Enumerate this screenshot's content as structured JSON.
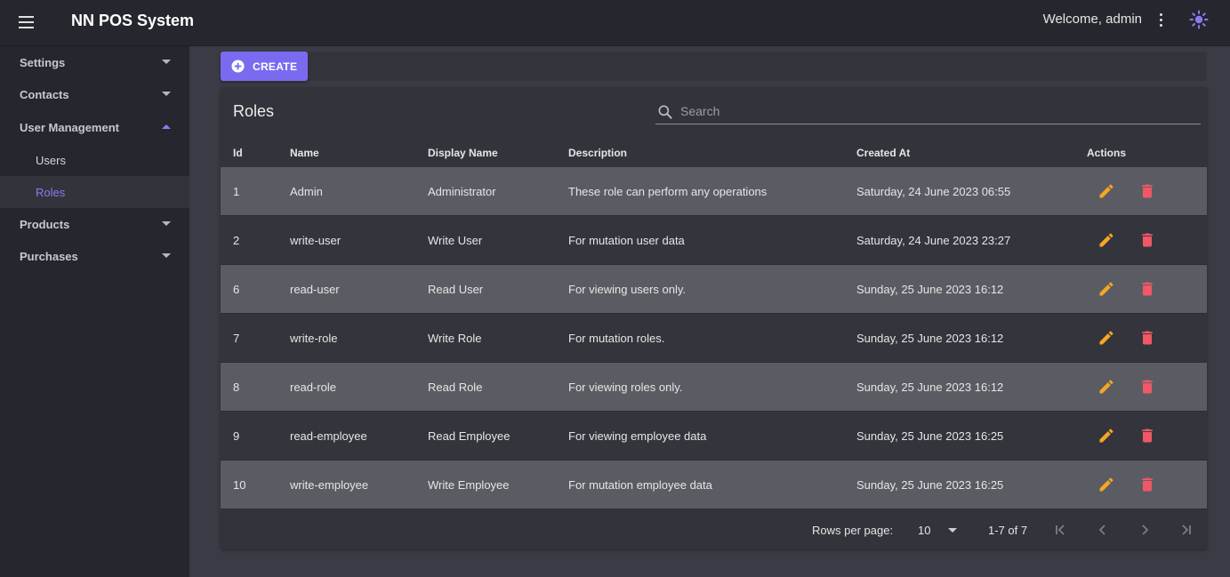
{
  "app": {
    "title": "NN POS System",
    "welcome": "Welcome, admin"
  },
  "colors": {
    "accent": "#7a6af0",
    "edit": "#f5a623",
    "delete": "#ef5867",
    "active_nav": "#8a7bf0"
  },
  "icons": {
    "menu": "menu-icon",
    "more": "more-vert-icon",
    "theme": "brightness-icon",
    "search": "search-icon",
    "add": "add-circle-icon",
    "edit": "pencil-icon",
    "delete": "trash-icon"
  },
  "sidebar": {
    "items": [
      {
        "label": "Settings"
      },
      {
        "label": "Contacts"
      },
      {
        "label": "User Management"
      },
      {
        "label": "Users"
      },
      {
        "label": "Roles"
      },
      {
        "label": "Products"
      },
      {
        "label": "Purchases"
      }
    ]
  },
  "toolbar": {
    "create_label": "CREATE"
  },
  "card": {
    "title": "Roles",
    "search_placeholder": "Search"
  },
  "table": {
    "columns": [
      "Id",
      "Name",
      "Display Name",
      "Description",
      "Created At",
      "Actions"
    ],
    "rows": [
      {
        "id": "1",
        "name": "Admin",
        "display": "Administrator",
        "desc": "These role can perform any operations",
        "created": "Saturday, 24 June 2023 06:55"
      },
      {
        "id": "2",
        "name": "write-user",
        "display": "Write User",
        "desc": "For mutation user data",
        "created": "Saturday, 24 June 2023 23:27"
      },
      {
        "id": "6",
        "name": "read-user",
        "display": "Read User",
        "desc": "For viewing users only.",
        "created": "Sunday, 25 June 2023 16:12"
      },
      {
        "id": "7",
        "name": "write-role",
        "display": "Write Role",
        "desc": "For mutation roles.",
        "created": "Sunday, 25 June 2023 16:12"
      },
      {
        "id": "8",
        "name": "read-role",
        "display": "Read Role",
        "desc": "For viewing roles only.",
        "created": "Sunday, 25 June 2023 16:12"
      },
      {
        "id": "9",
        "name": "read-employee",
        "display": "Read Employee",
        "desc": "For viewing employee data",
        "created": "Sunday, 25 June 2023 16:25"
      },
      {
        "id": "10",
        "name": "write-employee",
        "display": "Write Employee",
        "desc": "For mutation employee data",
        "created": "Sunday, 25 June 2023 16:25"
      }
    ]
  },
  "pagination": {
    "rows_label": "Rows per page:",
    "rows_value": "10",
    "range": "1-7 of 7"
  }
}
